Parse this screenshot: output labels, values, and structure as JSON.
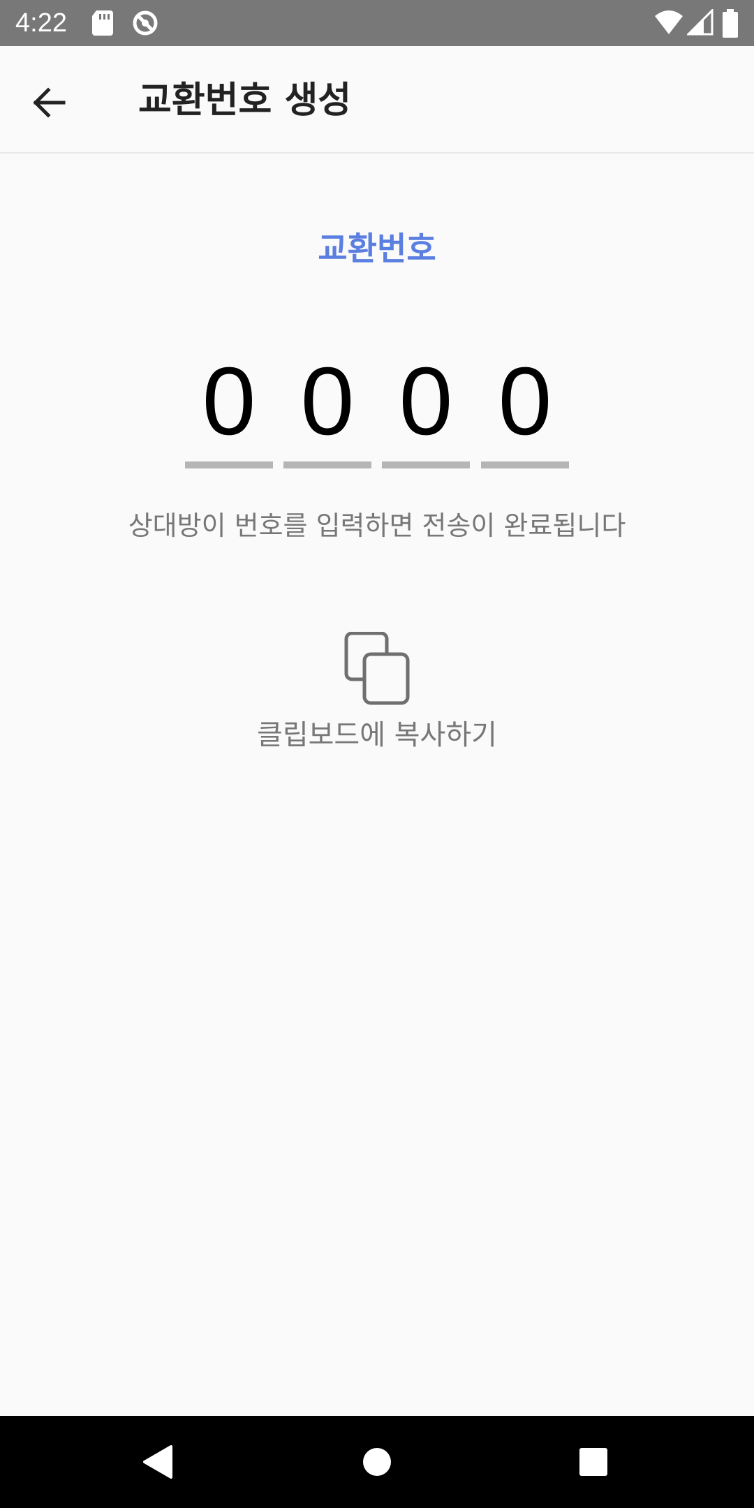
{
  "status_bar": {
    "time": "4:22",
    "icons": [
      "sd-card-icon",
      "sync-icon",
      "wifi-icon",
      "signal-icon",
      "battery-icon"
    ]
  },
  "app_bar": {
    "title": "교환번호 생성",
    "back_icon": "arrow-left-icon"
  },
  "main": {
    "code_label": "교환번호",
    "code_label_color": "#5b7fe0",
    "digits": [
      "0",
      "0",
      "0",
      "0"
    ],
    "hint": "상대방이 번호를 입력하면 전송이 완료됩니다",
    "copy_icon": "copy-icon",
    "copy_label": "클립보드에 복사하기"
  },
  "nav_bar": {
    "icons": [
      "back-triangle-icon",
      "home-circle-icon",
      "recents-square-icon"
    ]
  }
}
